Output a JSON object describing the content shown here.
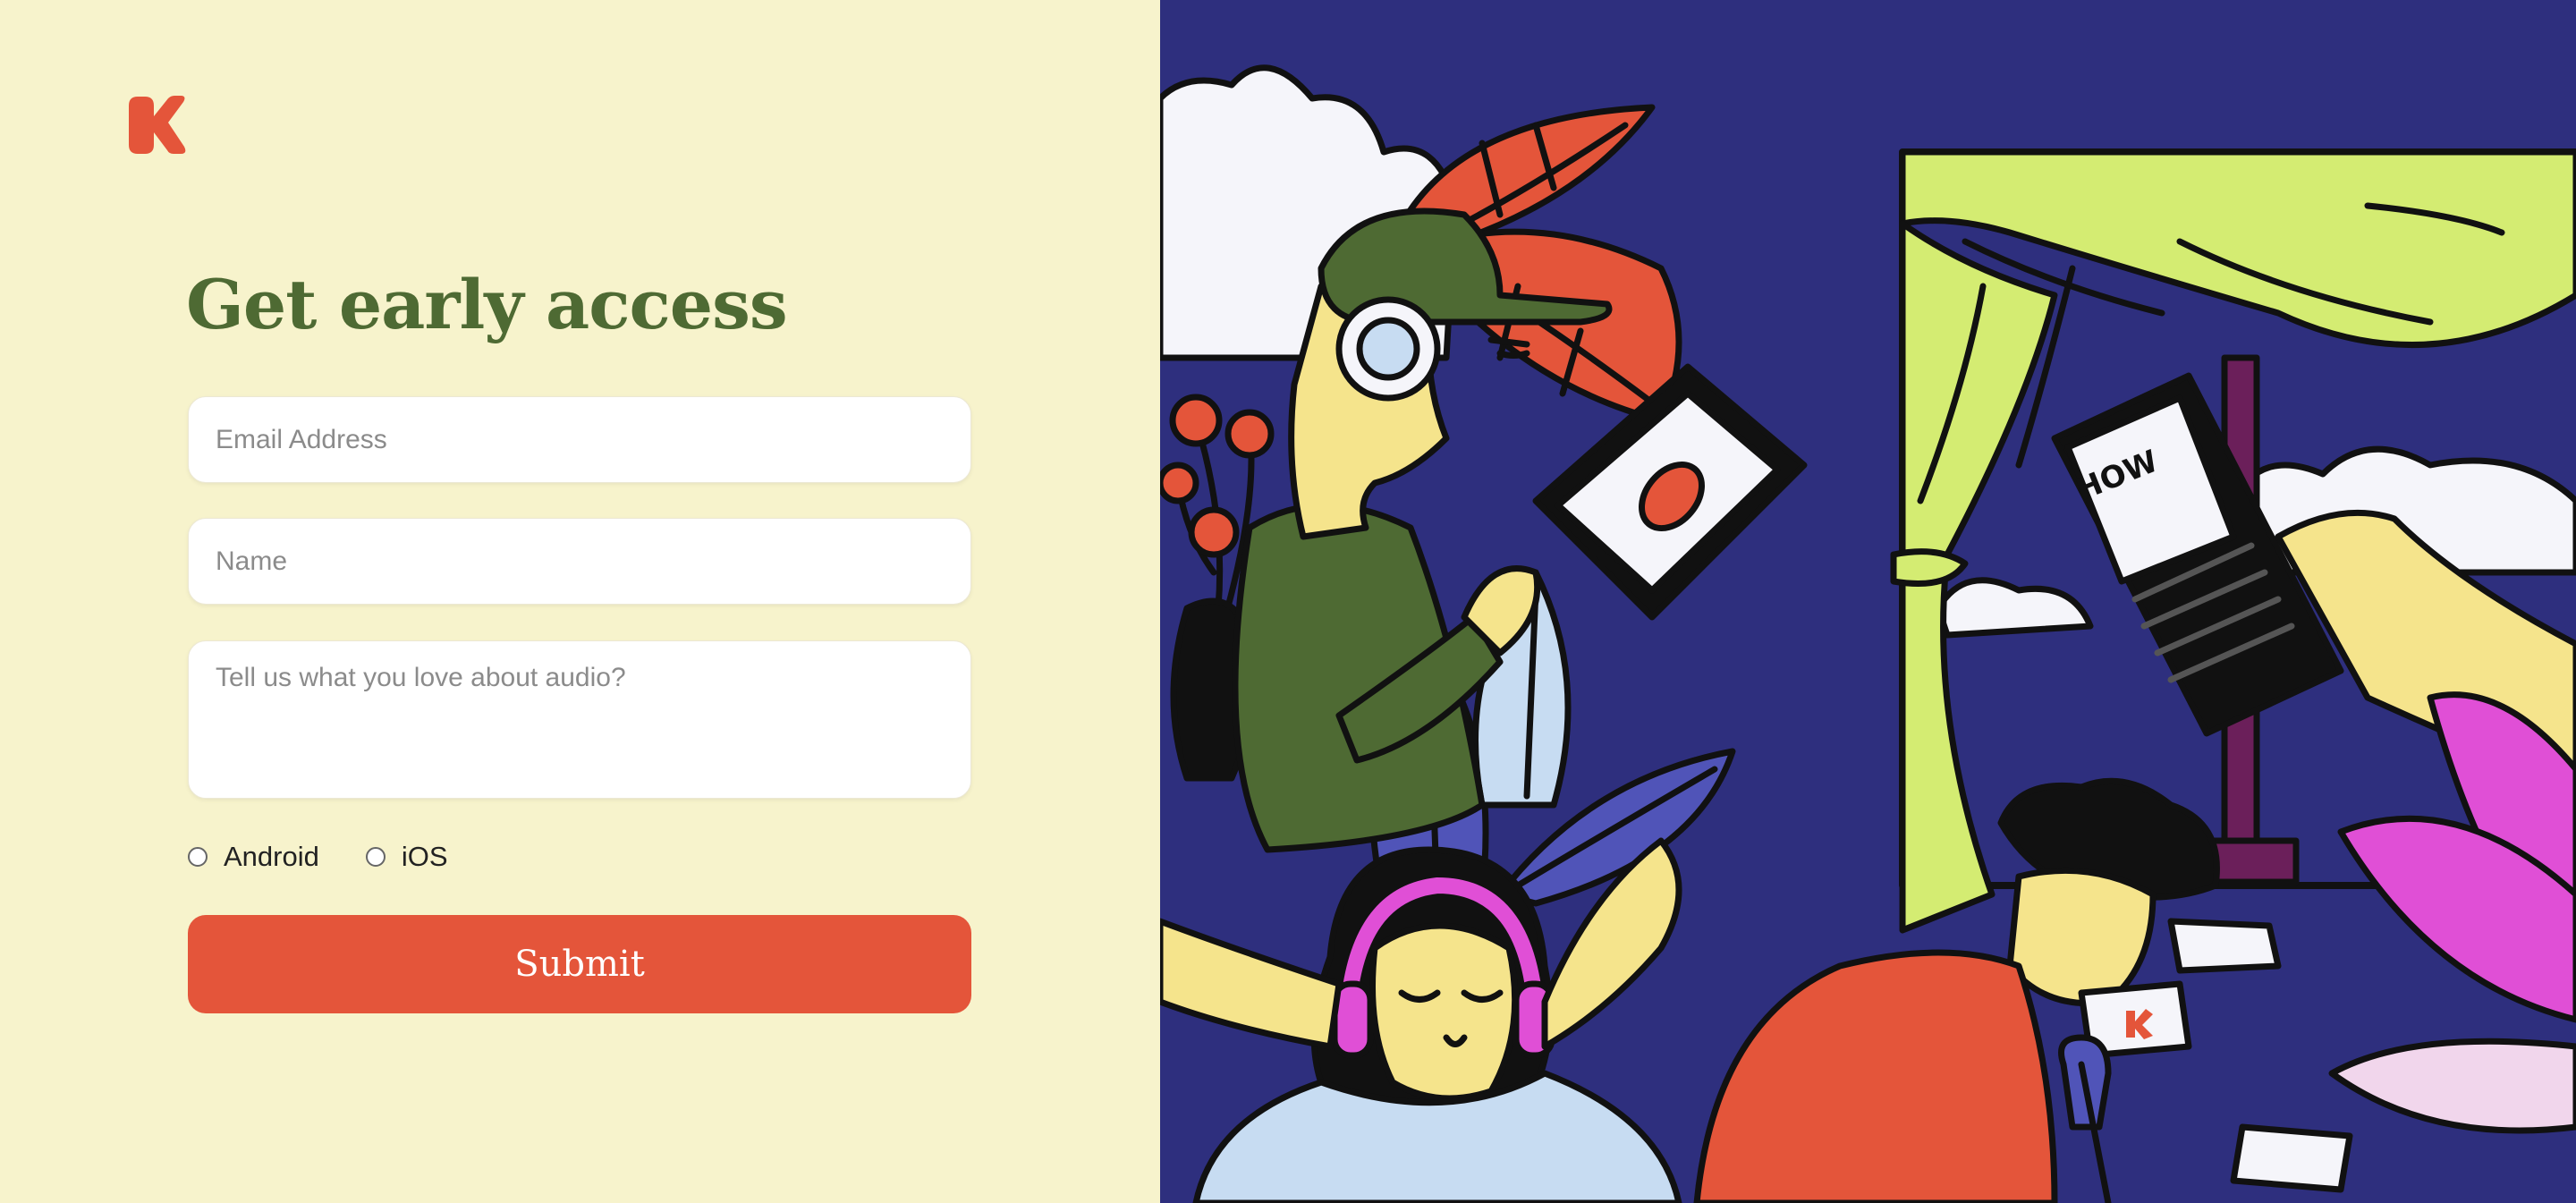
{
  "brand": {
    "logo_letter": "K",
    "color": "#e4553a"
  },
  "form": {
    "heading": "Get early access",
    "email_placeholder": "Email Address",
    "name_placeholder": "Name",
    "love_placeholder": "Tell us what you love about audio?",
    "platforms": [
      {
        "label": "Android",
        "selected": false
      },
      {
        "label": "iOS",
        "selected": false
      }
    ],
    "submit_label": "Submit"
  },
  "illustration": {
    "writing": "HOW"
  },
  "colors": {
    "cream": "#f7f3cc",
    "heading_green": "#4e6a33",
    "accent": "#e4553a",
    "illustration_navy": "#2e2f7e",
    "lime": "#d4ec72",
    "skin": "#f5e48c",
    "magenta": "#e04fd6"
  }
}
